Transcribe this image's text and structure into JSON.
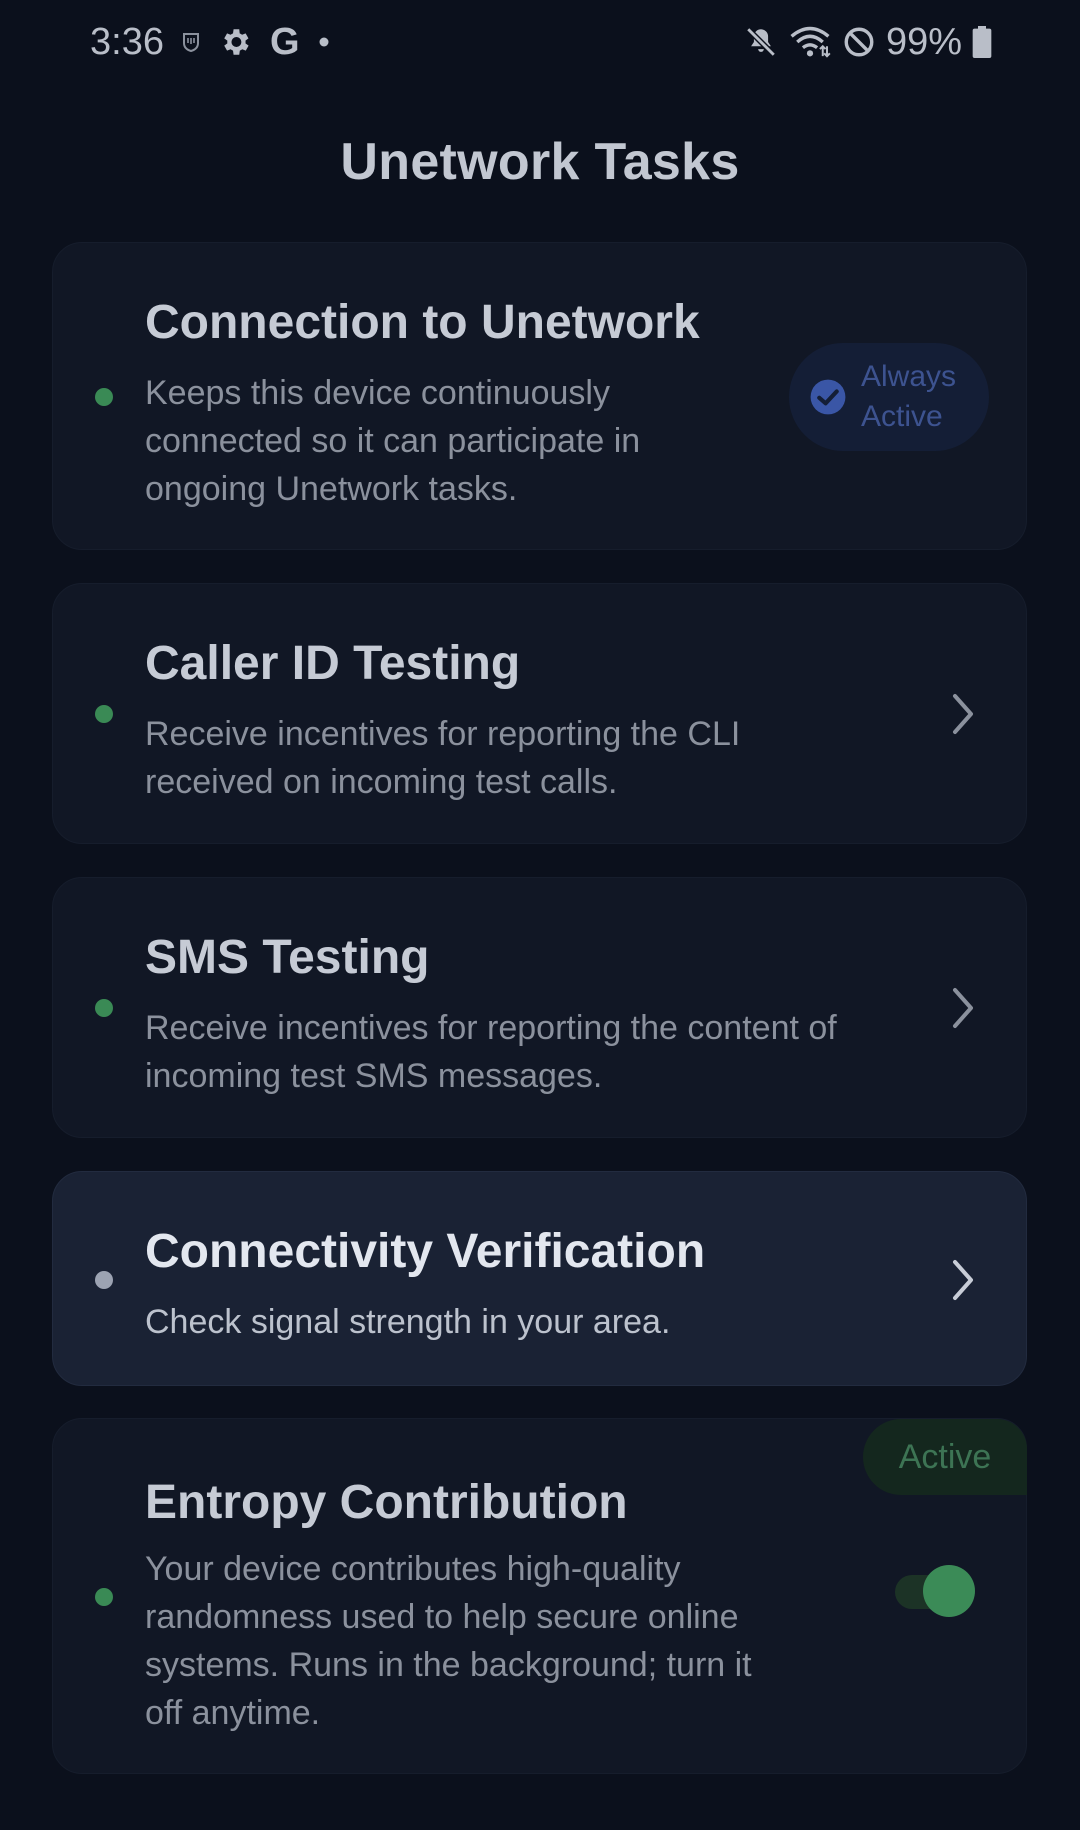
{
  "status_bar": {
    "time": "3:36",
    "left_icons": [
      "shield-icon",
      "gear-icon",
      "google-g-icon",
      "dot-icon"
    ],
    "google_letter": "G",
    "right_icons": [
      "mute-icon",
      "wifi-icon",
      "do-not-disturb-icon",
      "battery-icon"
    ],
    "battery": "99%"
  },
  "page": {
    "title": "Unetwork Tasks"
  },
  "tasks": [
    {
      "title": "Connection to Unetwork",
      "description": "Keeps this device continuously connected so it can participate in ongoing Unetwork tasks.",
      "status_dot": "green",
      "badge": {
        "line1": "Always",
        "line2": "Active",
        "icon": "check-circle-icon"
      }
    },
    {
      "title": "Caller ID Testing",
      "description": "Receive incentives for reporting the CLI received on incoming test calls.",
      "status_dot": "green",
      "action_icon": "chevron-right-icon"
    },
    {
      "title": "SMS Testing",
      "description": "Receive incentives for reporting the content of incoming test SMS messages.",
      "status_dot": "green",
      "action_icon": "chevron-right-icon"
    },
    {
      "title": "Connectivity Verification",
      "description": "Check signal strength in your area.",
      "status_dot": "grey",
      "action_icon": "chevron-right-icon"
    },
    {
      "title": "Entropy Contribution",
      "description": "Your device contributes high-quality randomness used to help secure online systems. Runs in the background; turn it off anytime.",
      "status_dot": "green",
      "status_label": "Active",
      "toggle_on": true
    }
  ],
  "colors": {
    "background": "#0b101c",
    "card": "#111725",
    "card_highlight": "#1a2234",
    "status_green": "#3a8a55",
    "badge_blue": "#3d5390"
  }
}
